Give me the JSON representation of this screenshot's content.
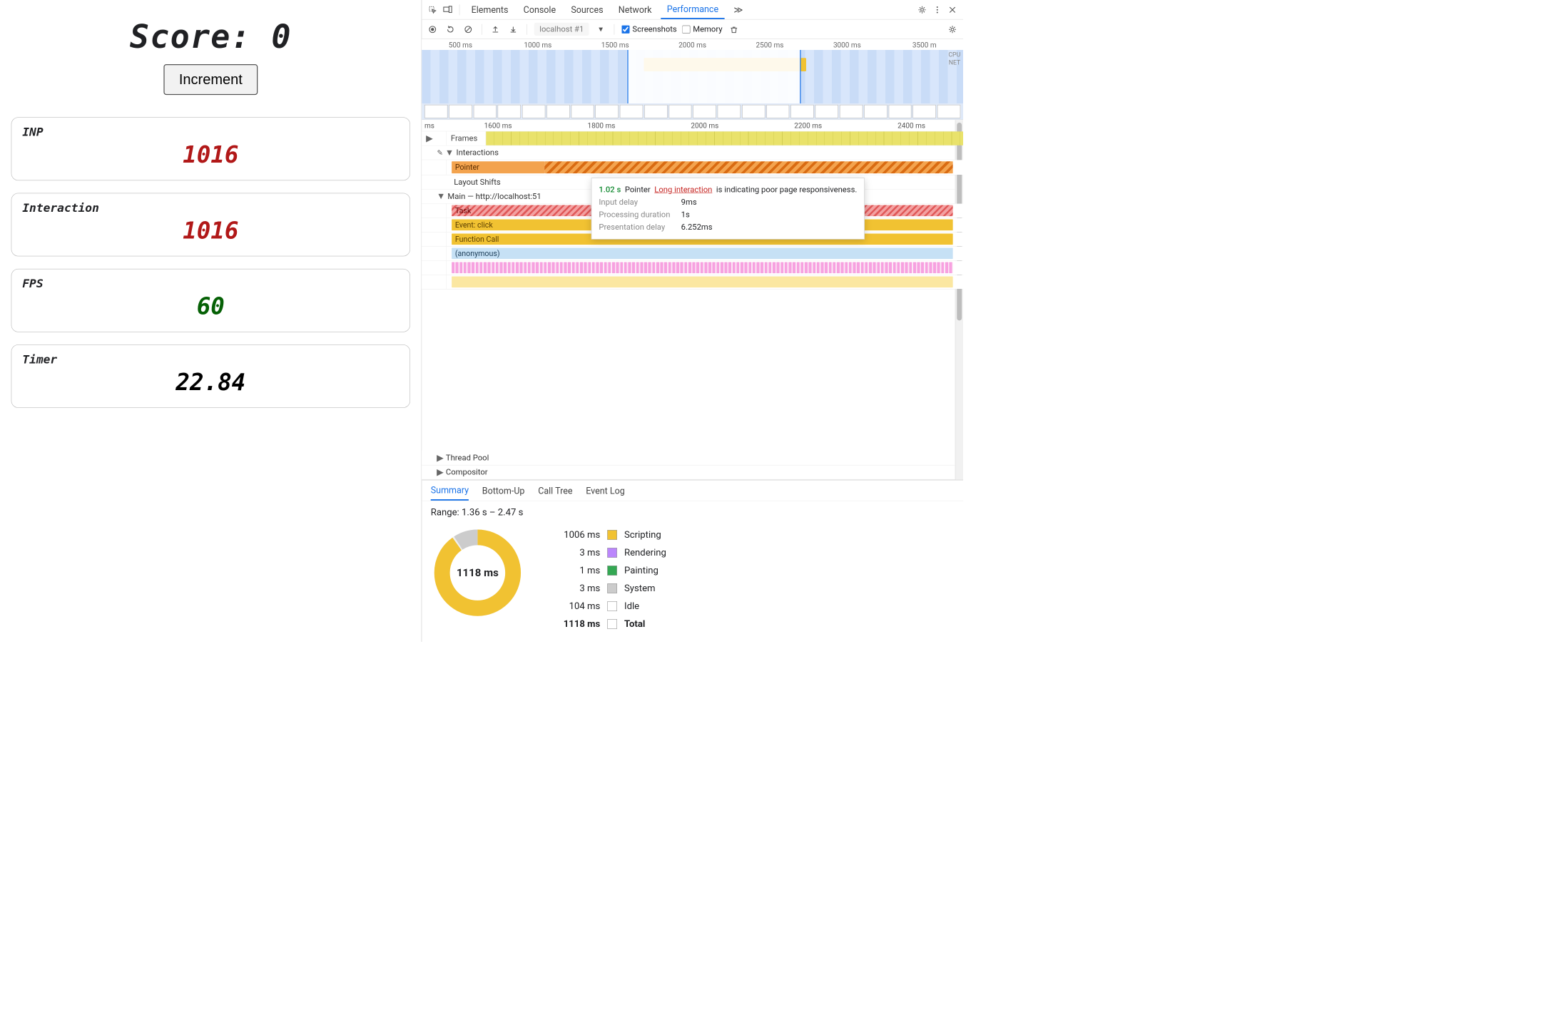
{
  "app": {
    "score_label": "Score:",
    "score_value": "0",
    "increment_label": "Increment",
    "cards": {
      "inp": {
        "label": "INP",
        "value": "1016"
      },
      "interaction": {
        "label": "Interaction",
        "value": "1016"
      },
      "fps": {
        "label": "FPS",
        "value": "60"
      },
      "timer": {
        "label": "Timer",
        "value": "22.84"
      }
    }
  },
  "devtools": {
    "tabs": {
      "elements": "Elements",
      "console": "Console",
      "sources": "Sources",
      "network": "Network",
      "performance": "Performance",
      "more": "≫"
    },
    "toolbar": {
      "profile_select": "localhost #1",
      "screenshots": "Screenshots",
      "memory": "Memory"
    },
    "overview_ticks": [
      "500 ms",
      "1000 ms",
      "1500 ms",
      "2000 ms",
      "2500 ms",
      "3000 ms",
      "3500 m"
    ],
    "overview_rlabels": [
      "CPU",
      "NET"
    ],
    "flame_ticks": [
      "ms",
      "1600 ms",
      "1800 ms",
      "2000 ms",
      "2200 ms",
      "2400 ms"
    ],
    "sections": {
      "frames": "Frames",
      "interactions": "Interactions",
      "pointer": "Pointer",
      "layout_shifts": "Layout Shifts",
      "main": "Main — http://localhost:51",
      "task": "Task",
      "event_click": "Event: click",
      "function_call": "Function Call",
      "anonymous": "(anonymous)",
      "thread_pool": "Thread Pool",
      "compositor": "Compositor"
    },
    "tooltip": {
      "time": "1.02 s",
      "kind": "Pointer",
      "link": "Long interaction",
      "tail": "is indicating poor page responsiveness.",
      "rows": {
        "input_delay_label": "Input delay",
        "input_delay_value": "9ms",
        "processing_label": "Processing duration",
        "processing_value": "1s",
        "presentation_label": "Presentation delay",
        "presentation_value": "6.252ms"
      }
    },
    "summary": {
      "tabs": {
        "summary": "Summary",
        "bottom_up": "Bottom-Up",
        "call_tree": "Call Tree",
        "event_log": "Event Log"
      },
      "range": "Range: 1.36 s – 2.47 s",
      "total_label": "1118 ms",
      "legend": {
        "scripting_ms": "1006 ms",
        "scripting": "Scripting",
        "rendering_ms": "3 ms",
        "rendering": "Rendering",
        "painting_ms": "1 ms",
        "painting": "Painting",
        "system_ms": "3 ms",
        "system": "System",
        "idle_ms": "104 ms",
        "idle": "Idle",
        "total_ms": "1118 ms",
        "total": "Total"
      }
    }
  },
  "chart_data": {
    "type": "pie",
    "title": "Range: 1.36 s – 2.47 s",
    "categories": [
      "Scripting",
      "Rendering",
      "Painting",
      "System",
      "Idle"
    ],
    "values": [
      1006,
      3,
      1,
      3,
      104
    ],
    "total": 1118,
    "unit": "ms",
    "colors": [
      "#f1c232",
      "#bb86fc",
      "#34a853",
      "#cccccc",
      "#ffffff"
    ]
  }
}
